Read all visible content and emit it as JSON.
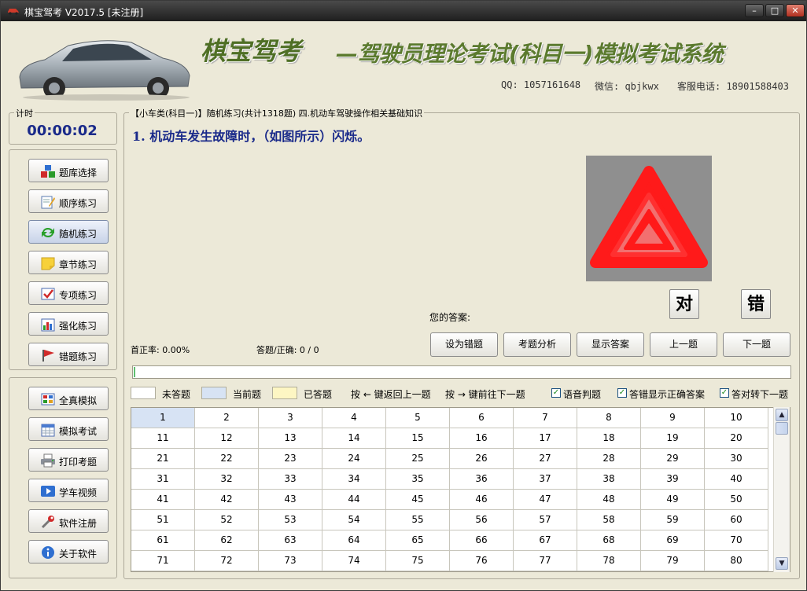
{
  "window": {
    "title": "棋宝驾考 V2017.5 [未注册]",
    "minimize_icon": "minimize-icon",
    "maximize_icon": "maximize-icon",
    "close_icon": "close-icon"
  },
  "header": {
    "brand": "棋宝驾考",
    "subtitle": "—驾驶员理论考试(科目一)模拟考试系统",
    "qq": "QQ: 1057161648",
    "wechat": "微信: qbjkwx",
    "phone": "客服电话: 18901588403"
  },
  "timer": {
    "label": "计时",
    "value": "00:00:02"
  },
  "sidebar": {
    "items": [
      {
        "label": "题库选择",
        "icon": "blocks-icon"
      },
      {
        "label": "顺序练习",
        "icon": "notepad-pencil-icon"
      },
      {
        "label": "随机练习",
        "icon": "refresh-icon",
        "active": true
      },
      {
        "label": "章节练习",
        "icon": "sticky-note-icon"
      },
      {
        "label": "专项练习",
        "icon": "checkmark-icon"
      },
      {
        "label": "强化练习",
        "icon": "bar-chart-icon"
      },
      {
        "label": "错题练习",
        "icon": "flag-icon"
      },
      {
        "label": "全真模拟",
        "icon": "grid-icon"
      },
      {
        "label": "模拟考试",
        "icon": "calendar-icon"
      },
      {
        "label": "打印考题",
        "icon": "printer-icon"
      },
      {
        "label": "学车视频",
        "icon": "video-play-icon"
      },
      {
        "label": "软件注册",
        "icon": "wrench-icon"
      },
      {
        "label": "关于软件",
        "icon": "info-icon"
      }
    ]
  },
  "question": {
    "header": "【小车类(科目一)】随机练习(共计1318题) 四.机动车驾驶操作相关基础知识",
    "text": "1. 机动车发生故障时，（如图所示）闪烁。",
    "image_icon": "hazard-warning-icon",
    "your_answer_label": "您的答案:",
    "true_label": "对",
    "false_label": "错"
  },
  "stats": {
    "first_correct_rate": "首正率: 0.00%",
    "answered": "答题/正确: 0 / 0"
  },
  "actions": {
    "mark_wrong": "设为错题",
    "analysis": "考题分析",
    "show_answer": "显示答案",
    "prev": "上一题",
    "next": "下一题"
  },
  "progress": {
    "fraction": 0.001
  },
  "legend": {
    "unanswered": "未答题",
    "current": "当前题",
    "answered": "已答题",
    "key_left": "按 ← 键返回上一题",
    "key_right": "按 → 键前往下一题",
    "unanswered_color": "#ffffff",
    "current_color": "#d7e3f4",
    "answered_color": "#fdf6c3"
  },
  "options": {
    "voice": {
      "label": "语音判题",
      "checked": true
    },
    "show_correct": {
      "label": "答错显示正确答案",
      "checked": true
    },
    "auto_next": {
      "label": "答对转下一题",
      "checked": true
    }
  },
  "grid": {
    "columns": 10,
    "numbers": [
      1,
      2,
      3,
      4,
      5,
      6,
      7,
      8,
      9,
      10,
      11,
      12,
      13,
      14,
      15,
      16,
      17,
      18,
      19,
      20,
      21,
      22,
      23,
      24,
      25,
      26,
      27,
      28,
      29,
      30,
      31,
      32,
      33,
      34,
      35,
      36,
      37,
      38,
      39,
      40,
      41,
      42,
      43,
      44,
      45,
      46,
      47,
      48,
      49,
      50,
      51,
      52,
      53,
      54,
      55,
      56,
      57,
      58,
      59,
      60,
      61,
      62,
      63,
      64,
      65,
      66,
      67,
      68,
      69,
      70,
      71,
      72,
      73,
      74,
      75,
      76,
      77,
      78,
      79,
      80
    ],
    "current": 1
  },
  "colors": {
    "accent_blue": "#1a2a8a",
    "brand_green": "#4f6f25",
    "hazard_red": "#ff2020"
  }
}
